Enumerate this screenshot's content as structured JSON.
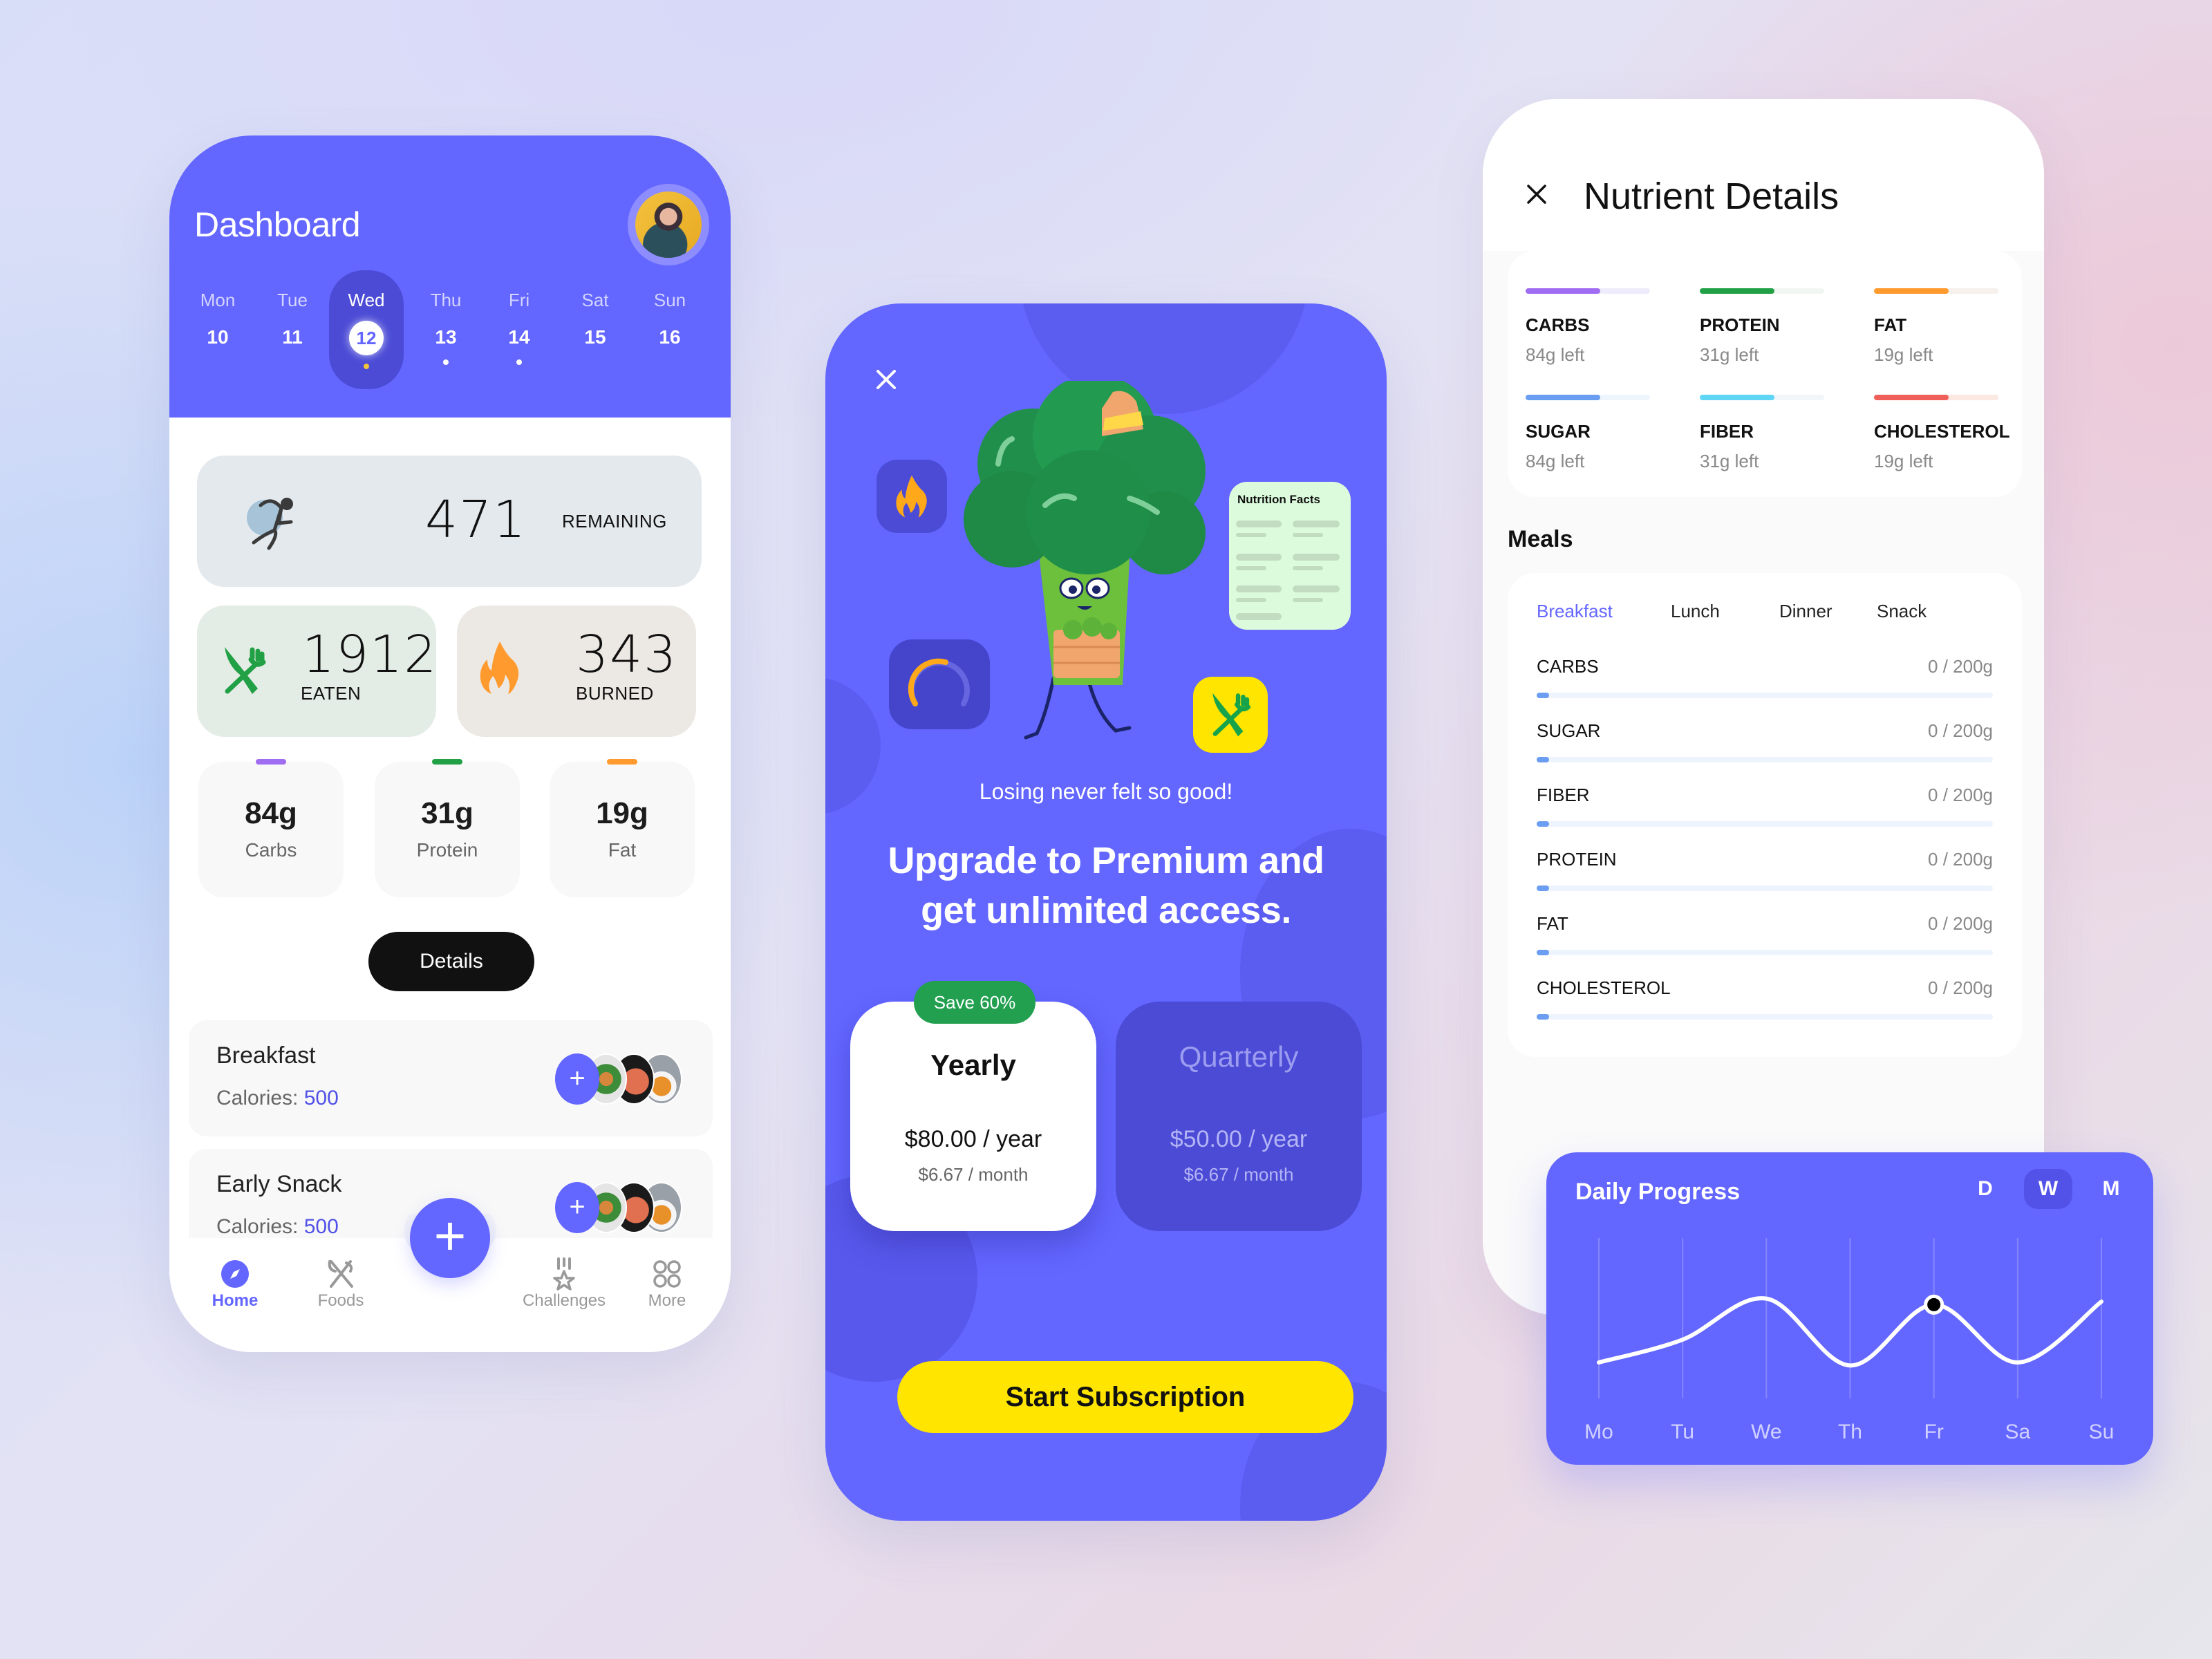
{
  "dashboard": {
    "title": "Dashboard",
    "week": [
      {
        "day": "Mon",
        "date": "10",
        "dot": false,
        "active": false
      },
      {
        "day": "Tue",
        "date": "11",
        "dot": false,
        "active": false
      },
      {
        "day": "Wed",
        "date": "12",
        "dot": true,
        "active": true
      },
      {
        "day": "Thu",
        "date": "13",
        "dot": true,
        "active": false
      },
      {
        "day": "Fri",
        "date": "14",
        "dot": true,
        "active": false
      },
      {
        "day": "Sat",
        "date": "15",
        "dot": false,
        "active": false
      },
      {
        "day": "Sun",
        "date": "16",
        "dot": false,
        "active": false
      }
    ],
    "remaining": {
      "value": "471",
      "label": "REMAINING"
    },
    "eaten": {
      "value": "1912",
      "label": "EATEN"
    },
    "burned": {
      "value": "343",
      "label": "BURNED"
    },
    "macros": [
      {
        "value": "84g",
        "label": "Carbs",
        "color": "#a06cf2"
      },
      {
        "value": "31g",
        "label": "Protein",
        "color": "#22a045"
      },
      {
        "value": "19g",
        "label": "Fat",
        "color": "#ff9a2e"
      }
    ],
    "details_label": "Details",
    "meals": [
      {
        "name": "Breakfast",
        "calories_label": "Calories:",
        "calories": "500"
      },
      {
        "name": "Early Snack",
        "calories_label": "Calories:",
        "calories": "500"
      }
    ],
    "tabs": [
      {
        "label": "Home",
        "icon": "compass-icon",
        "active": true
      },
      {
        "label": "Foods",
        "icon": "utensils-icon",
        "active": false
      },
      {
        "label": "Challenges",
        "icon": "medal-icon",
        "active": false
      },
      {
        "label": "More",
        "icon": "grid-icon",
        "active": false
      }
    ]
  },
  "premium": {
    "nutrition_facts_label": "Nutrition Facts",
    "subtitle": "Losing never felt so good!",
    "title_line1": "Upgrade to Premium and",
    "title_line2": "get unlimited access.",
    "save_badge": "Save 60%",
    "plans": [
      {
        "name": "Yearly",
        "price": "$80.00 / year",
        "monthly": "$6.67 / month",
        "selected": true
      },
      {
        "name": "Quarterly",
        "price": "$50.00 / year",
        "monthly": "$6.67 / month",
        "selected": false
      }
    ],
    "cta": "Start Subscription",
    "colors": {
      "brand": "#6366ff",
      "cta": "#ffe500",
      "badge": "#22a050"
    }
  },
  "nutrient_details": {
    "title": "Nutrient Details",
    "nutrients": [
      {
        "name": "CARBS",
        "left": "84g left",
        "fill": 0.6,
        "color": "#a06cf2",
        "track": "#eeecfb"
      },
      {
        "name": "PROTEIN",
        "left": "31g left",
        "fill": 0.6,
        "color": "#22a045",
        "track": "#f2f6f3"
      },
      {
        "name": "FAT",
        "left": "19g left",
        "fill": 0.6,
        "color": "#ff9a2e",
        "track": "#f6f1ec"
      },
      {
        "name": "SUGAR",
        "left": "84g left",
        "fill": 0.6,
        "color": "#6b9ef2",
        "track": "#eef5fd"
      },
      {
        "name": "FIBER",
        "left": "31g left",
        "fill": 0.6,
        "color": "#5fd6f6",
        "track": "#f2f6f8"
      },
      {
        "name": "CHOLESTEROL",
        "left": "19g left",
        "fill": 0.6,
        "color": "#f0605a",
        "track": "#fbe8e0"
      }
    ],
    "meals_title": "Meals",
    "meal_tabs": [
      {
        "label": "Breakfast",
        "active": true
      },
      {
        "label": "Lunch",
        "active": false
      },
      {
        "label": "Dinner",
        "active": false
      },
      {
        "label": "Snack",
        "active": false
      }
    ],
    "meal_rows": [
      {
        "name": "CARBS",
        "value": "0 / 200g"
      },
      {
        "name": "SUGAR",
        "value": "0 / 200g"
      },
      {
        "name": "FIBER",
        "value": "0 / 200g"
      },
      {
        "name": "PROTEIN",
        "value": "0 / 200g"
      },
      {
        "name": "FAT",
        "value": "0 / 200g"
      },
      {
        "name": "CHOLESTEROL",
        "value": "0 / 200g"
      }
    ]
  },
  "daily_progress": {
    "title": "Daily Progress",
    "periods": [
      {
        "label": "D",
        "active": false
      },
      {
        "label": "W",
        "active": true
      },
      {
        "label": "M",
        "active": false
      }
    ]
  },
  "chart_data": {
    "type": "line",
    "title": "Daily Progress",
    "categories": [
      "Mo",
      "Tu",
      "We",
      "Th",
      "Fr",
      "Sa",
      "Su"
    ],
    "series": [
      {
        "name": "Progress",
        "values": [
          30,
          45,
          72,
          28,
          68,
          30,
          70
        ]
      }
    ],
    "highlight_index": 4,
    "ylim": [
      0,
      100
    ],
    "grid": "vertical",
    "xlabel": "",
    "ylabel": ""
  }
}
